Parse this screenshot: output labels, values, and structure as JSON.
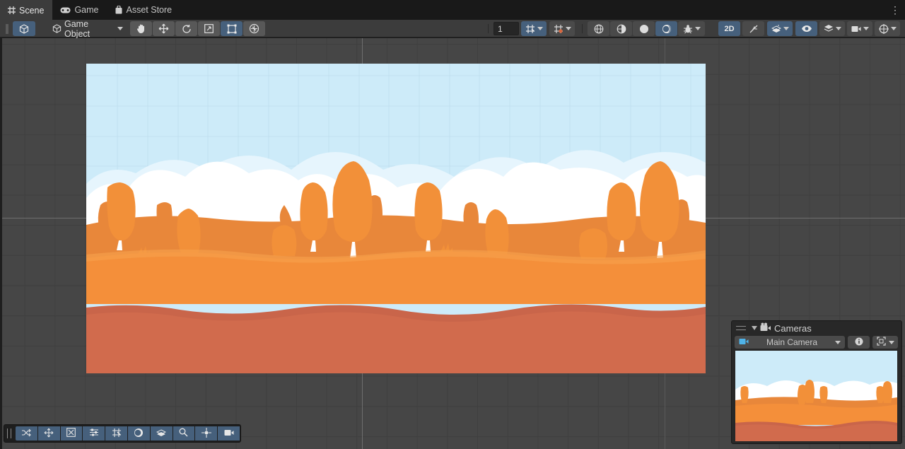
{
  "tabs": [
    {
      "label": "Scene",
      "icon": "grid-icon",
      "active": true
    },
    {
      "label": "Game",
      "icon": "gamepad-icon",
      "active": false
    },
    {
      "label": "Asset Store",
      "icon": "shopping-bag-icon",
      "active": false
    }
  ],
  "toolbar": {
    "game_object_label": "Game Object",
    "grid_snap_value": "1",
    "mode_2d_label": "2D"
  },
  "cameras_overlay": {
    "title": "Cameras",
    "selected_camera": "Main Camera"
  },
  "colors": {
    "sky": "#cdebf9",
    "cloud": "#ffffff",
    "tree_orange": "#f29039",
    "hill_far": "#e8873a",
    "ground_mid": "#f48f3a",
    "ground_stripe": "#c9654a",
    "ground_bottom": "#d16b4d",
    "accent_blue": "#46607c"
  }
}
